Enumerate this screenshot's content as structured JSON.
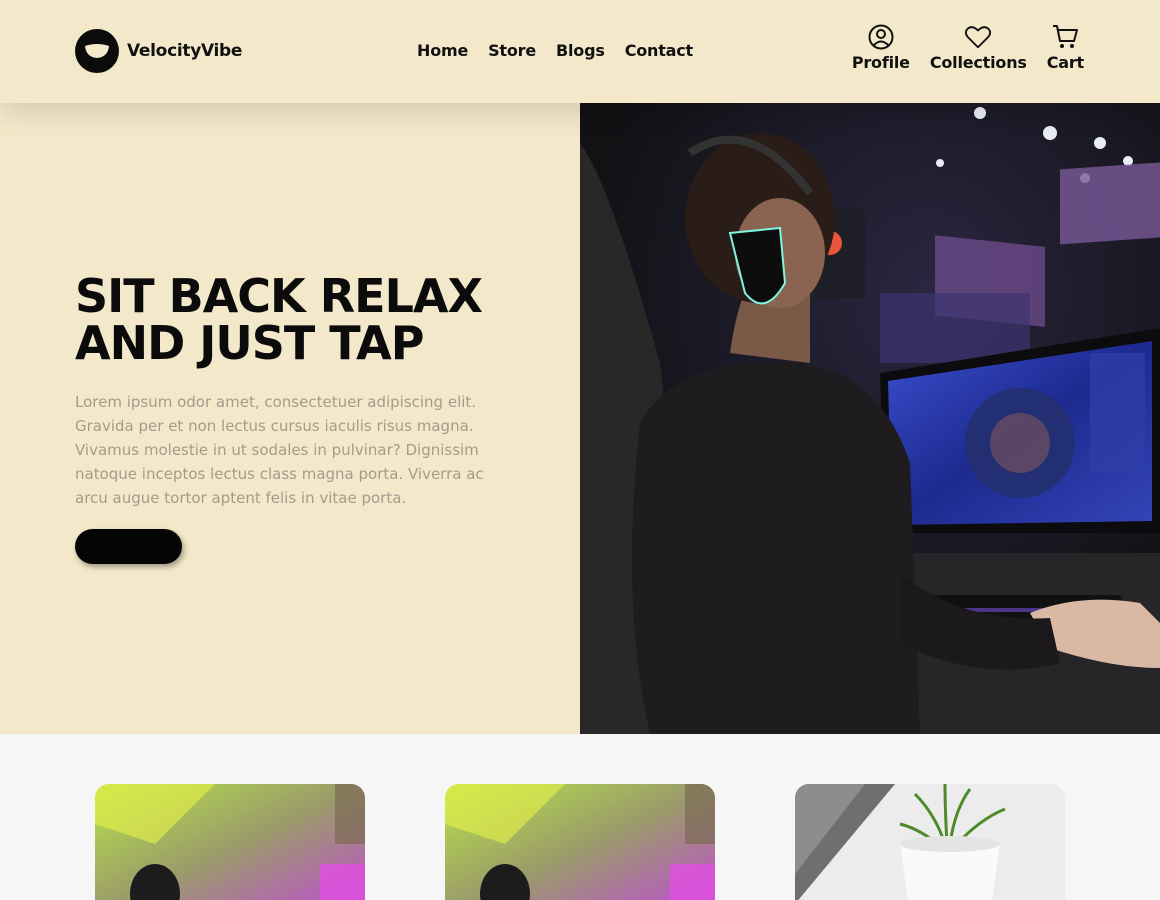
{
  "brand": {
    "name": "VelocityVibe",
    "logo_icon": "smile-face-icon"
  },
  "nav": {
    "items": [
      "Home",
      "Store",
      "Blogs",
      "Contact"
    ]
  },
  "actions": [
    {
      "label": "Profile",
      "icon": "user-circle-icon"
    },
    {
      "label": "Collections",
      "icon": "heart-icon"
    },
    {
      "label": "Cart",
      "icon": "cart-icon"
    }
  ],
  "hero": {
    "title_line1": "SIT BACK RELAX",
    "title_line2": "AND JUST TAP",
    "text": "Lorem ipsum odor amet, consectetuer adipiscing elit. Gravida per et non lectus cursus iaculis risus magna. Vivamus molestie in ut sodales in pulvinar? Dignissim natoque inceptos lectus class magna porta. Viverra ac arcu augue tortor aptent felis in vitae porta.",
    "button_label": "",
    "image": "gamer-with-headset-playing-on-monitor-photo"
  },
  "cards": [
    {
      "image": "neon-gaming-room-chair-photo"
    },
    {
      "image": "neon-gaming-room-chair-photo"
    },
    {
      "image": "white-potted-plant-photo"
    }
  ],
  "colors": {
    "header_bg": "#f3e8c9",
    "hero_bg": "#f3e8c9",
    "text_dark": "#111111",
    "text_muted": "#a39c8d",
    "button": "#050505",
    "section_bg": "#f6f6f6"
  }
}
